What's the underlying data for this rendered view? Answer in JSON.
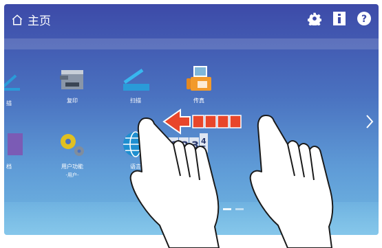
{
  "header": {
    "title": "主页",
    "icons": [
      "home-icon",
      "gear-icon",
      "info-icon",
      "help-icon"
    ]
  },
  "tiles": [
    {
      "label": "描",
      "icon": "scanner-icon"
    },
    {
      "label": "复印",
      "icon": "copier-icon"
    },
    {
      "label": "扫描",
      "icon": "flatbed-scan-icon"
    },
    {
      "label": "传真",
      "icon": "fax-icon"
    },
    {
      "label": "档",
      "icon": "document-icon"
    },
    {
      "label": "用户功能",
      "sub": "-用户-",
      "icon": "gears-icon"
    },
    {
      "label": "语言",
      "icon": "globe-icon"
    },
    {
      "label": "",
      "icon": "numbers-icon",
      "glyph": "123"
    }
  ],
  "pager": {
    "count": 3,
    "active": 1
  },
  "colors": {
    "bg_top": "#3d4aa8",
    "bg_bottom": "#72b9e3",
    "arrow": "#e8462b"
  }
}
